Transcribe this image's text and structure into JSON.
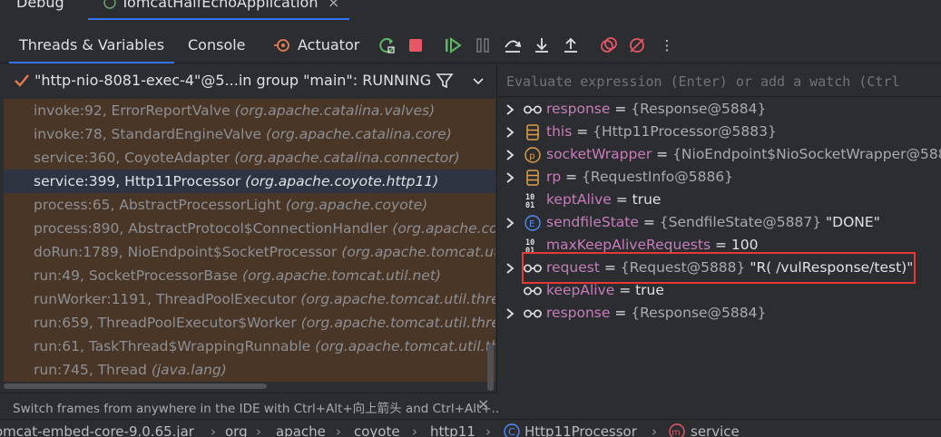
{
  "window": {
    "debug_label": "Debug",
    "run_tab_label": "TomcatHalfEchoApplication",
    "close_glyph": "×"
  },
  "toolbar": {
    "tabs": [
      "Threads & Variables",
      "Console",
      "Actuator"
    ],
    "more_glyph": "⋮"
  },
  "thread": {
    "label": "\"http-nio-8081-exec-4\"@5...in group \"main\": RUNNING"
  },
  "frames": [
    {
      "method": "invoke:92, ErrorReportValve ",
      "pkg": "(org.apache.catalina.valves)"
    },
    {
      "method": "invoke:78, StandardEngineValve ",
      "pkg": "(org.apache.catalina.core)"
    },
    {
      "method": "service:360, CoyoteAdapter ",
      "pkg": "(org.apache.catalina.connector)"
    },
    {
      "method": "service:399, Http11Processor ",
      "pkg": "(org.apache.coyote.http11)",
      "selected": true
    },
    {
      "method": "process:65, AbstractProcessorLight ",
      "pkg": "(org.apache.coyote)"
    },
    {
      "method": "process:890, AbstractProtocol$ConnectionHandler ",
      "pkg": "(org.apache.co"
    },
    {
      "method": "doRun:1789, NioEndpoint$SocketProcessor ",
      "pkg": "(org.apache.tomcat.uti"
    },
    {
      "method": "run:49, SocketProcessorBase ",
      "pkg": "(org.apache.tomcat.util.net)"
    },
    {
      "method": "runWorker:1191, ThreadPoolExecutor ",
      "pkg": "(org.apache.tomcat.util.threa"
    },
    {
      "method": "run:659, ThreadPoolExecutor$Worker ",
      "pkg": "(org.apache.tomcat.util.threa"
    },
    {
      "method": "run:61, TaskThread$WrappingRunnable ",
      "pkg": "(org.apache.tomcat.util.thr"
    },
    {
      "method": "run:745, Thread ",
      "pkg": "(java.lang)"
    }
  ],
  "hint": {
    "text": "Switch frames from anywhere in the IDE with Ctrl+Alt+向上箭头 and Ctrl+Alt+..",
    "close_glyph": "×"
  },
  "evaluate": {
    "placeholder": "Evaluate expression (Enter) or add a watch (Ctrl"
  },
  "variables": [
    {
      "name": "response",
      "eq": " = ",
      "value": "{Response@5884}",
      "extra": "",
      "icon": "watch-glasses-icon",
      "expandable": true
    },
    {
      "name": "this",
      "eq": " = ",
      "value": "{Http11Processor@5883}",
      "extra": "",
      "icon": "field-stack-icon",
      "expandable": true
    },
    {
      "name": "socketWrapper",
      "eq": " = ",
      "value": "{NioEndpoint$NioSocketWrapper@588",
      "extra": "",
      "icon": "parameter-icon",
      "expandable": true
    },
    {
      "name": "rp",
      "eq": " = ",
      "value": "{RequestInfo@5886}",
      "extra": "",
      "icon": "field-stack-icon",
      "expandable": true
    },
    {
      "name": "keptAlive",
      "eq": " = ",
      "value": "",
      "extra": "true",
      "icon": "binary-icon",
      "expandable": false
    },
    {
      "name": "sendfileState",
      "eq": " = ",
      "value": "{SendfileState@5887} ",
      "extra": "\"DONE\"",
      "icon": "enum-icon",
      "expandable": true
    },
    {
      "name": "maxKeepAliveRequests",
      "eq": " = ",
      "value": "",
      "extra": "100",
      "icon": "binary-icon",
      "expandable": false
    },
    {
      "name": "request",
      "eq": " = ",
      "value": "{Request@5888} ",
      "extra": "\"R( /vulResponse/test)\"",
      "icon": "watch-glasses-icon",
      "expandable": true
    },
    {
      "name": "keepAlive",
      "eq": " = ",
      "value": "",
      "extra": "true",
      "icon": "watch-glasses-icon",
      "expandable": false
    },
    {
      "name": "response",
      "eq": " = ",
      "value": "{Response@5884}",
      "extra": "",
      "icon": "watch-glasses-icon",
      "expandable": true
    }
  ],
  "breadcrumbs": [
    "omcat-embed-core-9.0.65.jar",
    "org",
    "apache",
    "coyote",
    "http11",
    "Http11Processor",
    "service"
  ],
  "colors": {
    "accent": "#3574f0",
    "frame_bg": "#4a3626",
    "selected_frame_bg": "#2e3442",
    "var_name": "#c77dbb",
    "highlight_box": "#e53935"
  }
}
